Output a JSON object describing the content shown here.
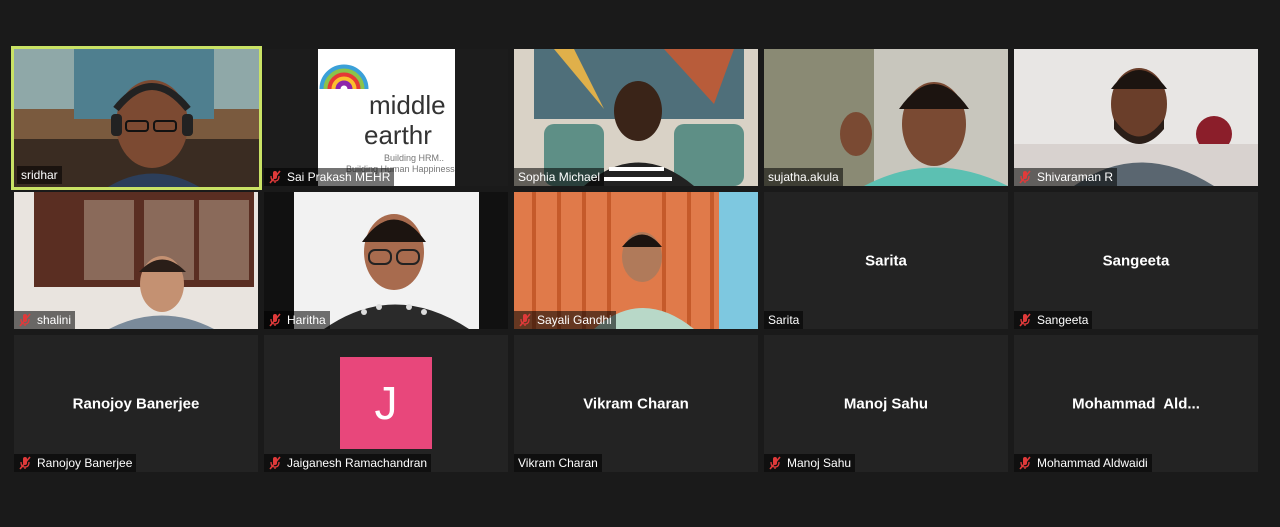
{
  "participants": [
    {
      "name": "sridhar",
      "muted": false,
      "active": true
    },
    {
      "name": "Sai Prakash MEHR",
      "muted": true
    },
    {
      "name": "Sophia Michael",
      "muted": false
    },
    {
      "name": "sujatha.akula",
      "muted": false
    },
    {
      "name": "Shivaraman R",
      "muted": true
    },
    {
      "name": "shalini",
      "muted": true
    },
    {
      "name": "Haritha",
      "muted": true
    },
    {
      "name": "Sayali Gandhi",
      "muted": true
    },
    {
      "name": "Sarita",
      "display": "Sarita",
      "muted": false
    },
    {
      "name": "Sangeeta",
      "display": "Sangeeta",
      "muted": true
    },
    {
      "name": "Ranojoy Banerjee",
      "display": "Ranojoy Banerjee",
      "muted": true
    },
    {
      "name": "Jaiganesh Ramachandran",
      "avatar_letter": "J",
      "avatar_color": "#e8477b",
      "muted": true
    },
    {
      "name": "Vikram Charan",
      "display": "Vikram Charan",
      "muted": false
    },
    {
      "name": "Manoj Sahu",
      "display": "Manoj Sahu",
      "muted": true
    },
    {
      "name": "Mohammad Aldwaidi",
      "display": "Mohammad  Ald...",
      "muted": true
    }
  ],
  "logo": {
    "line1": "middle",
    "line2": "earthr",
    "tag1": "Building HRM..",
    "tag2": "Building Human Happiness"
  },
  "colors": {
    "active_border": "#c9e265",
    "mute_icon": "#e03a3a"
  }
}
